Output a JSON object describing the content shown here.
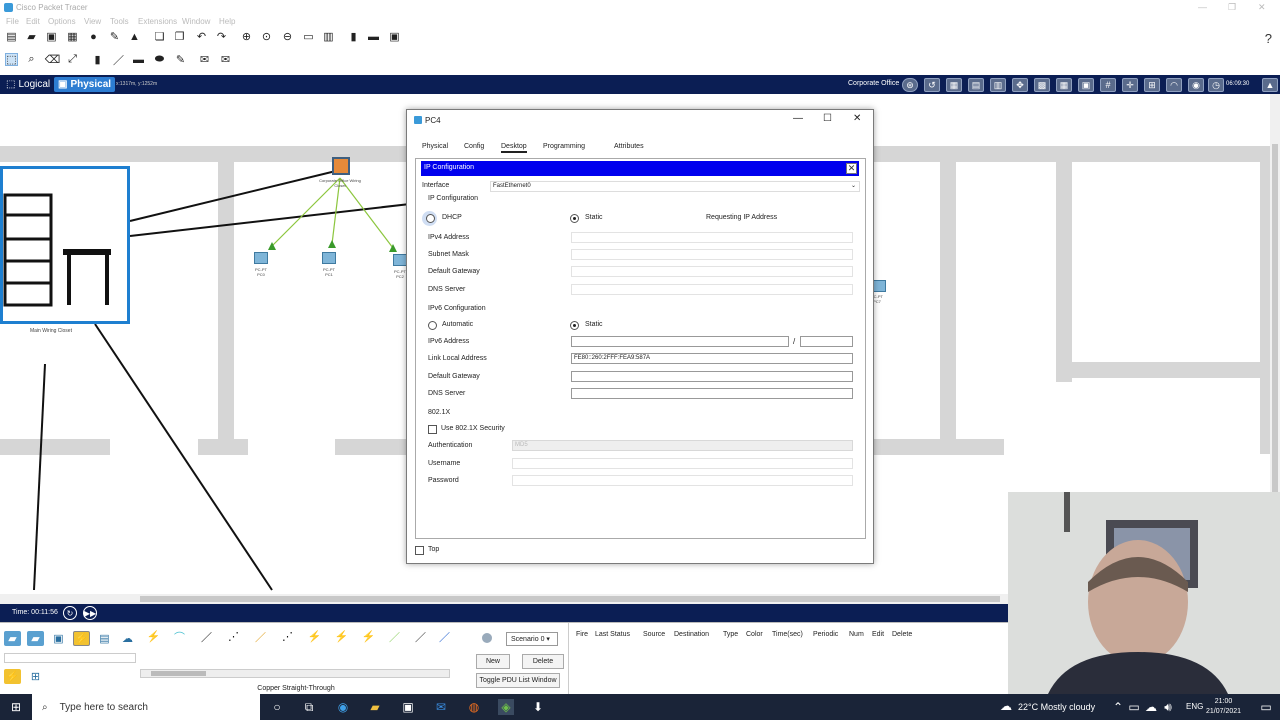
{
  "app": {
    "title": "Cisco Packet Tracer"
  },
  "menu": [
    "File",
    "Edit",
    "Options",
    "View",
    "Tools",
    "Extensions",
    "Window",
    "Help"
  ],
  "workspace_bar": {
    "logical_label": "Logical",
    "physical_label": "Physical",
    "coords": "x:1317m, y:1252m",
    "location": "Corporate Office",
    "clock": "06:09:30"
  },
  "workspace": {
    "closet_label": "Main Wiring Closet",
    "switch_label": "Corporate Office Wiring Closet",
    "pcs": [
      {
        "line1": "PC-PT",
        "line2": "PC0"
      },
      {
        "line1": "PC-PT",
        "line2": "PC1"
      },
      {
        "line1": "PC-PT",
        "line2": "PC2"
      },
      {
        "line1": "PC-PT",
        "line2": "PC7"
      }
    ]
  },
  "dialog": {
    "title": "PC4",
    "tabs": [
      "Physical",
      "Config",
      "Desktop",
      "Programming",
      "Attributes"
    ],
    "active_tab": "Desktop",
    "ip_config": {
      "header": "IP Configuration",
      "interface_label": "Interface",
      "interface_value": "FastEthernet0",
      "section_label": "IP Configuration",
      "dhcp_label": "DHCP",
      "static_label": "Static",
      "status": "Requesting IP Address",
      "ipv4_label": "IPv4 Address",
      "subnet_label": "Subnet Mask",
      "gateway_label": "Default Gateway",
      "dns_label": "DNS Server",
      "ipv6_section": "IPv6 Configuration",
      "auto_label": "Automatic",
      "ipv6_static_label": "Static",
      "ipv6_addr_label": "IPv6 Address",
      "slash": "/",
      "link_local_label": "Link Local Address",
      "link_local_value": "FE80::260:2FFF:FEA9:587A",
      "ipv6_gateway_label": "Default Gateway",
      "ipv6_dns_label": "DNS Server",
      "dot1x_section": "802.1X",
      "dot1x_check": "Use 802.1X Security",
      "auth_label": "Authentication",
      "auth_value": "MD5",
      "username_label": "Username",
      "password_label": "Password"
    },
    "top_label": "Top"
  },
  "timebar": {
    "time": "Time: 00:11:56"
  },
  "bottom": {
    "cable_type": "Copper Straight-Through",
    "scenario": "Scenario 0",
    "new_label": "New",
    "delete_label": "Delete",
    "toggle_label": "Toggle PDU List Window",
    "pdu_columns": [
      "Fire",
      "Last Status",
      "Source",
      "Destination",
      "Type",
      "Color",
      "Time(sec)",
      "Periodic",
      "Num",
      "Edit",
      "Delete"
    ]
  },
  "taskbar": {
    "search_placeholder": "Type here to search",
    "weather": "22°C  Mostly cloudy",
    "lang": "ENG",
    "time": "21:00",
    "date": "21/07/2021"
  },
  "colors": {
    "workspace_bar": "#0b1e54",
    "ipc_header": "#0000ee",
    "closet_border": "#1e7fd0"
  }
}
